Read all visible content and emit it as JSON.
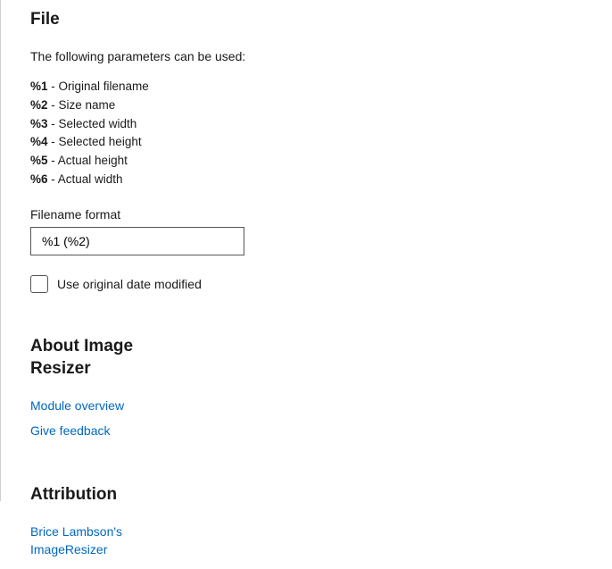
{
  "file": {
    "heading": "File",
    "intro": "The following parameters can be used:",
    "params": [
      {
        "code": "%1",
        "desc": "Original filename"
      },
      {
        "code": "%2",
        "desc": "Size name"
      },
      {
        "code": "%3",
        "desc": "Selected width"
      },
      {
        "code": "%4",
        "desc": "Selected height"
      },
      {
        "code": "%5",
        "desc": "Actual height"
      },
      {
        "code": "%6",
        "desc": "Actual width"
      }
    ],
    "filename_label": "Filename format",
    "filename_value": "%1 (%2)",
    "use_original_date_label": "Use original date modified",
    "use_original_date_checked": false
  },
  "about": {
    "heading": "About Image Resizer",
    "overview_link": "Module overview",
    "feedback_link": "Give feedback"
  },
  "attribution": {
    "heading": "Attribution",
    "link": "Brice Lambson's ImageResizer"
  }
}
